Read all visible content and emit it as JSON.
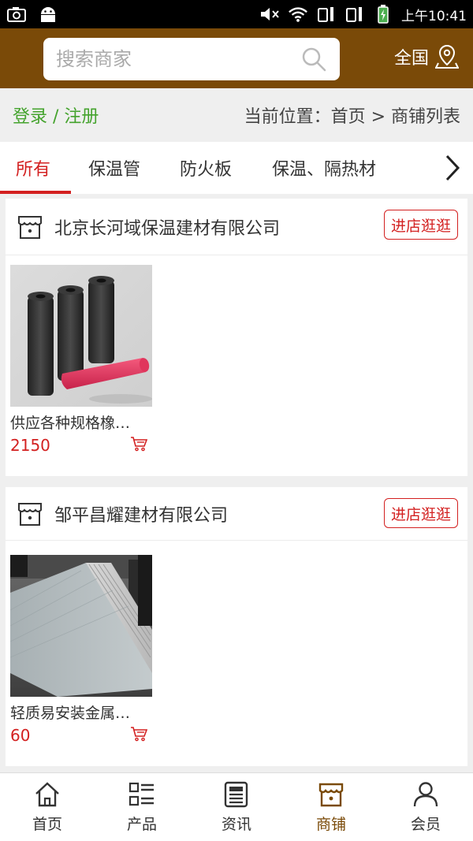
{
  "status_bar": {
    "time": "上午10:41"
  },
  "header": {
    "search_placeholder": "搜索商家",
    "region_label": "全国"
  },
  "breadcrumb": {
    "login": "登录 / 注册",
    "location": "当前位置：首页 > 商铺列表"
  },
  "tabs": [
    {
      "label": "所有",
      "active": true
    },
    {
      "label": "保温管"
    },
    {
      "label": "防火板"
    },
    {
      "label": "保温、隔热材"
    }
  ],
  "shops": [
    {
      "name": "北京长河域保温建材有限公司",
      "visit_label": "进店逛逛",
      "product": {
        "name": "供应各种规格橡…",
        "price": "2150"
      }
    },
    {
      "name": "邹平昌耀建材有限公司",
      "visit_label": "进店逛逛",
      "product": {
        "name": "轻质易安装金属…",
        "price": "60"
      }
    }
  ],
  "bottom_nav": [
    {
      "label": "首页",
      "icon": "home-icon"
    },
    {
      "label": "产品",
      "icon": "list-icon"
    },
    {
      "label": "资讯",
      "icon": "news-icon"
    },
    {
      "label": "商铺",
      "icon": "shop-icon",
      "active": true
    },
    {
      "label": "会员",
      "icon": "user-icon"
    }
  ],
  "colors": {
    "brand": "#7a4a08",
    "accent": "#d32020",
    "login_green": "#44a32d"
  }
}
